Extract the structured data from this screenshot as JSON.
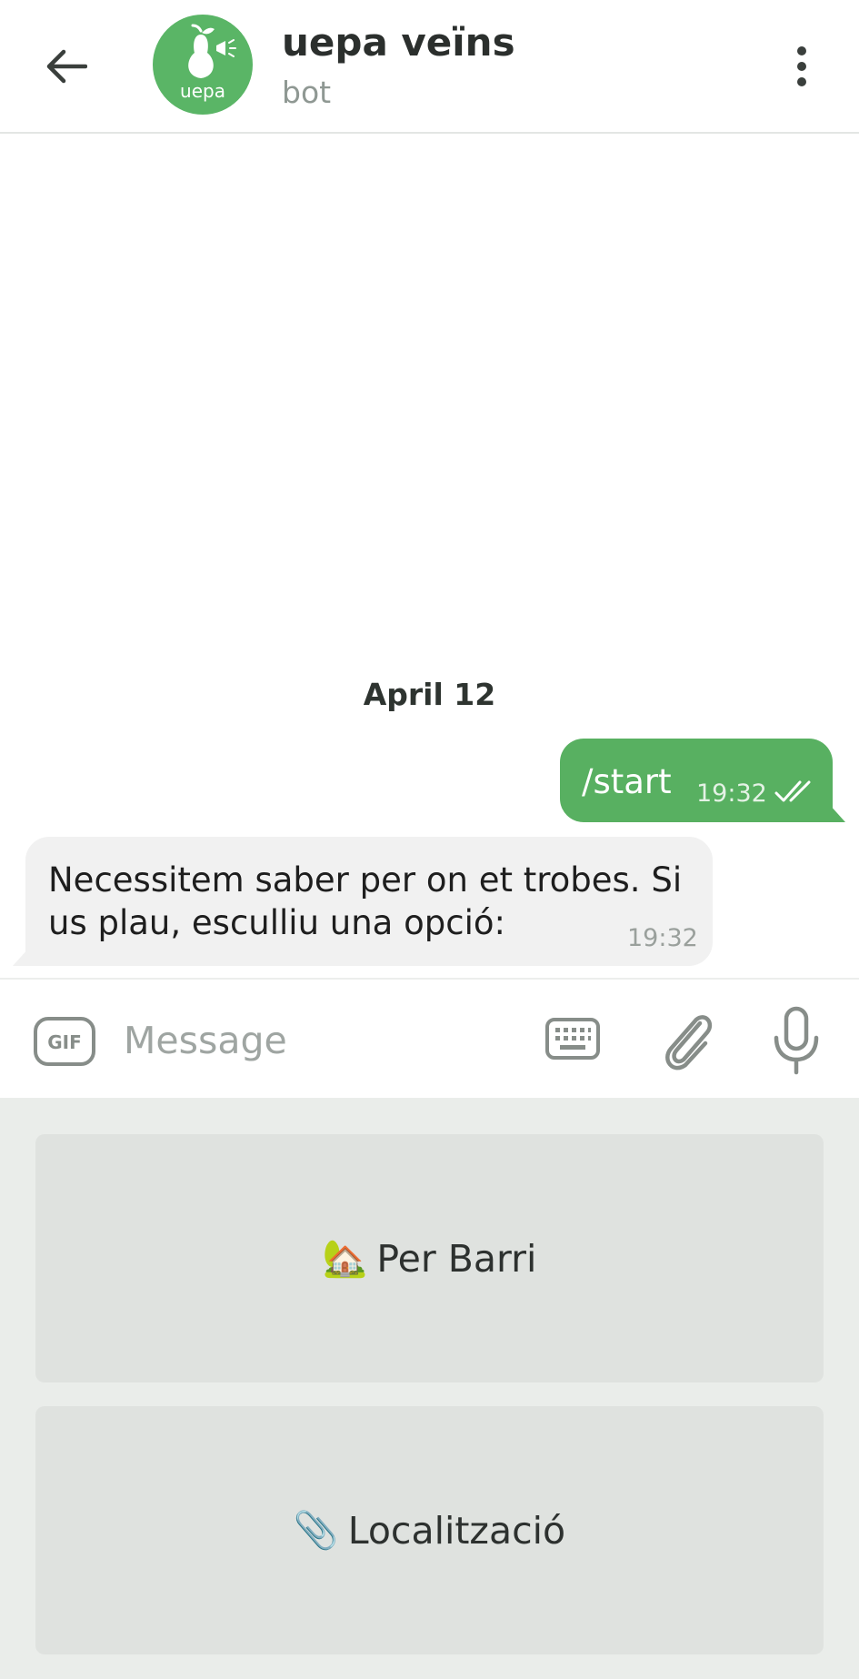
{
  "header": {
    "title": "uepa veïns",
    "subtitle": "bot",
    "avatar_text": "uepa",
    "back_icon": "arrow-left-icon",
    "menu_icon": "more-vertical-icon"
  },
  "chat": {
    "date": "April 12",
    "messages": [
      {
        "direction": "outgoing",
        "text": "/start",
        "time": "19:32",
        "status": "read"
      },
      {
        "direction": "incoming",
        "text": "Necessitem saber per on et trobes. Si us plau, esculliu una opció:",
        "time": "19:32"
      }
    ]
  },
  "input": {
    "placeholder": "Message",
    "value": "",
    "gif_label": "GIF"
  },
  "reply_keyboard": {
    "buttons": [
      {
        "emoji": "🏡",
        "label": "Per Barri"
      },
      {
        "emoji": "📎",
        "label": "Localització"
      }
    ]
  },
  "colors": {
    "accent": "#58b061",
    "avatar_bg": "#5ab566",
    "incoming_bubble": "#f1f1f1",
    "keyboard_bg": "#eaedea",
    "keyboard_button": "#dfe2df"
  }
}
